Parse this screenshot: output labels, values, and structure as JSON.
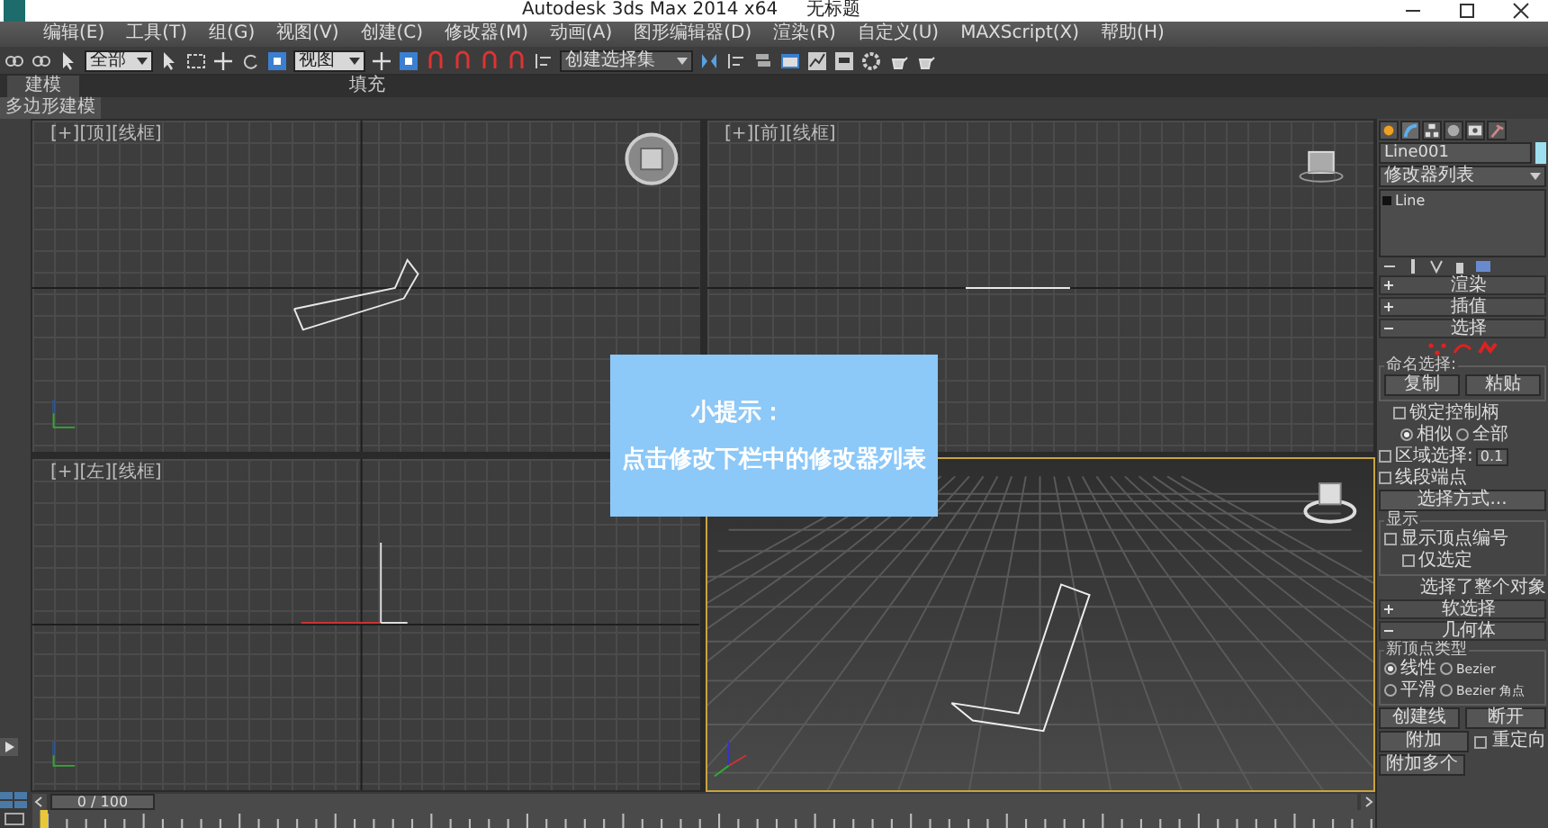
{
  "window": {
    "title": "Autodesk 3ds Max  2014 x64",
    "document": "无标题"
  },
  "menu": [
    "编辑(E)",
    "工具(T)",
    "组(G)",
    "视图(V)",
    "创建(C)",
    "修改器(M)",
    "动画(A)",
    "图形编辑器(D)",
    "渲染(R)",
    "自定义(U)",
    "MAXScript(X)",
    "帮助(H)"
  ],
  "toolbar": {
    "selection_filter": "全部",
    "coordinate_system": "视图",
    "named_selection_set": "创建选择集"
  },
  "ribbon": {
    "tabs": [
      {
        "label": "建模",
        "selected": true
      },
      {
        "label": "填充",
        "selected": false
      }
    ],
    "panel": "多边形建模"
  },
  "viewports": [
    {
      "kind": "top",
      "labels": [
        "[+]",
        "[顶]",
        "[线框]"
      ],
      "active": false
    },
    {
      "kind": "front",
      "labels": [
        "[+]",
        "[前]",
        "[线框]"
      ],
      "active": false
    },
    {
      "kind": "left",
      "labels": [
        "[+]",
        "[左]",
        "[线框]"
      ],
      "active": false
    },
    {
      "kind": "perspective",
      "active": true
    }
  ],
  "tip": {
    "title": "小提示：",
    "text": "点击修改下栏中的修改器列表"
  },
  "command_panel": {
    "tabs": [
      {
        "kind": "create",
        "selected": false
      },
      {
        "kind": "modify",
        "selected": true
      },
      {
        "kind": "hierarchy",
        "selected": false
      },
      {
        "kind": "motion",
        "selected": false
      },
      {
        "kind": "display",
        "selected": false
      },
      {
        "kind": "utilities",
        "selected": false
      }
    ],
    "object_name": "Line001",
    "modifier_list": "修改器列表",
    "stack": [
      {
        "label": "Line",
        "selected": false
      }
    ],
    "rollouts_top": [
      {
        "label": "渲染",
        "expanded": false
      },
      {
        "label": "插值",
        "expanded": false
      },
      {
        "label": "选择",
        "expanded": true
      }
    ],
    "selection": {
      "named_selection": {
        "title": "命名选择:",
        "buttons": [
          "复制",
          "粘贴"
        ]
      },
      "lock_handles": {
        "label": "锁定控制柄",
        "checked": false
      },
      "handle_mode": [
        {
          "label": "相似",
          "selected": true
        },
        {
          "label": "全部",
          "selected": false
        }
      ],
      "area_selection": {
        "label": "区域选择:",
        "checked": false,
        "value": "0.1"
      },
      "segment_end": {
        "label": "线段端点",
        "checked": false
      },
      "select_by": "选择方式...",
      "display": {
        "title": "显示",
        "options": [
          {
            "label": "显示顶点编号",
            "checked": false
          },
          {
            "label": "仅选定",
            "checked": false
          }
        ]
      },
      "status": "选择了整个对象"
    },
    "rollouts_bottom": [
      {
        "label": "软选择",
        "expanded": false
      },
      {
        "label": "几何体",
        "expanded": true
      }
    ],
    "geometry": {
      "vertex_type": {
        "title": "新顶点类型",
        "options": [
          {
            "label": "线性",
            "selected": true
          },
          {
            "label": "Bezier",
            "selected": false
          },
          {
            "label": "平滑",
            "selected": false
          },
          {
            "label": "Bezier 角点",
            "selected": false
          }
        ]
      },
      "buttons": [
        "创建线",
        "断开",
        "附加"
      ],
      "reorient": {
        "label": "重定向",
        "checked": false
      },
      "attach_multiple": "附加多个"
    }
  },
  "timeline": {
    "frame": "0 / 100",
    "level": 0
  }
}
